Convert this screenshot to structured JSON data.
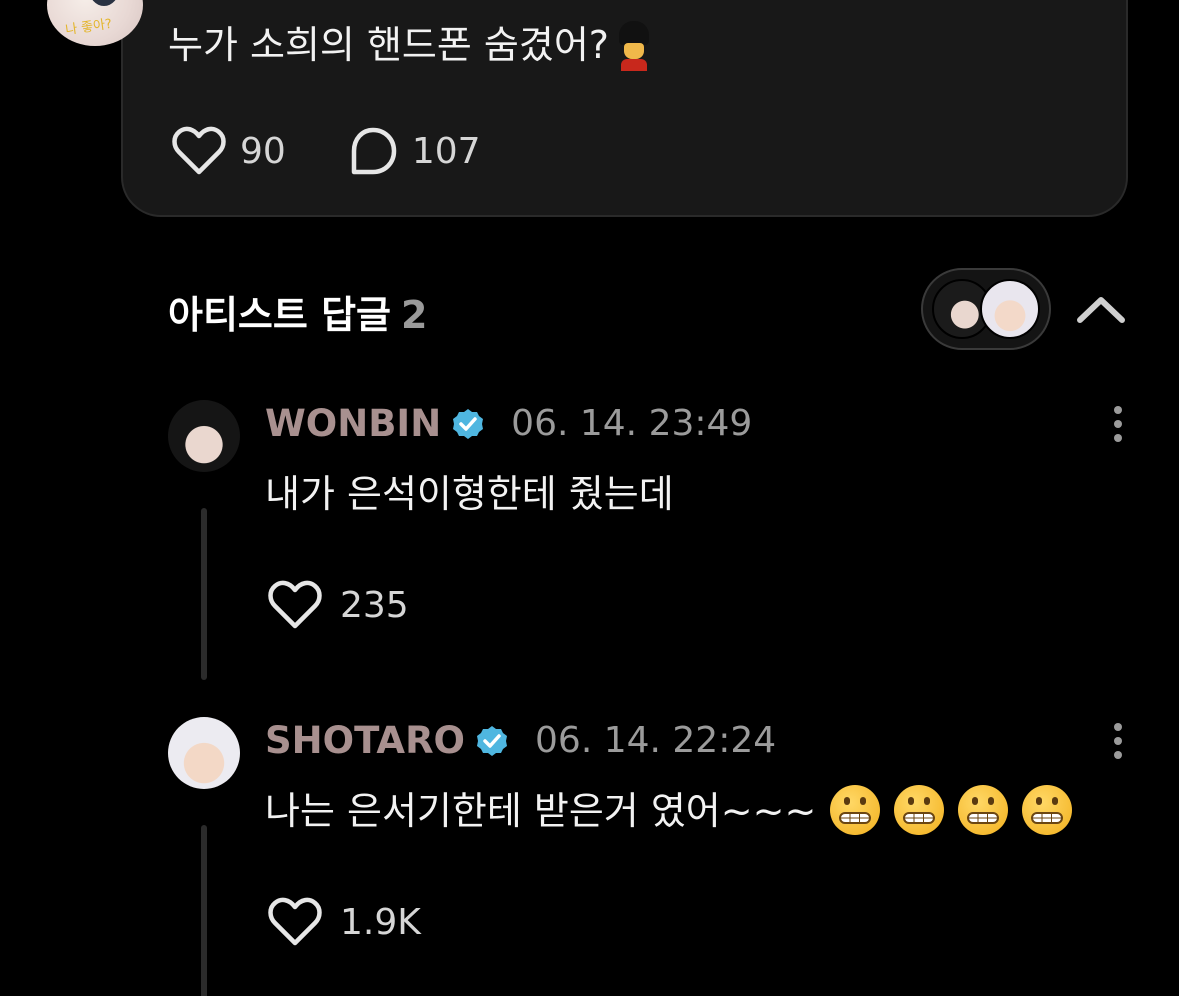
{
  "post": {
    "text": "누가 소희의 핸드폰 숨겼어?",
    "emoji_icon": "british-guard-emoji",
    "avatar_doodle": "나 좋아?",
    "likes": "90",
    "comments": "107"
  },
  "artist_replies": {
    "title": "아티스트 답글",
    "count": "2",
    "collapse_icon": "chevron-up-icon"
  },
  "replies": [
    {
      "name": "WONBIN",
      "verified": true,
      "time": "06. 14. 23:49",
      "text": "내가 은석이형한테 줬는데",
      "likes": "235"
    },
    {
      "name": "SHOTARO",
      "verified": true,
      "time": "06. 14. 22:24",
      "text": "나는 은서기한테 받은거 였어~~~",
      "emoji_icon": "grimacing-face-emoji",
      "emoji_count": 4,
      "likes": "1.9K"
    }
  ],
  "colors": {
    "background": "#000000",
    "card": "#181818",
    "name": "#a8908f",
    "verified": "#4fb6e0",
    "muted": "#9b9b9b"
  }
}
